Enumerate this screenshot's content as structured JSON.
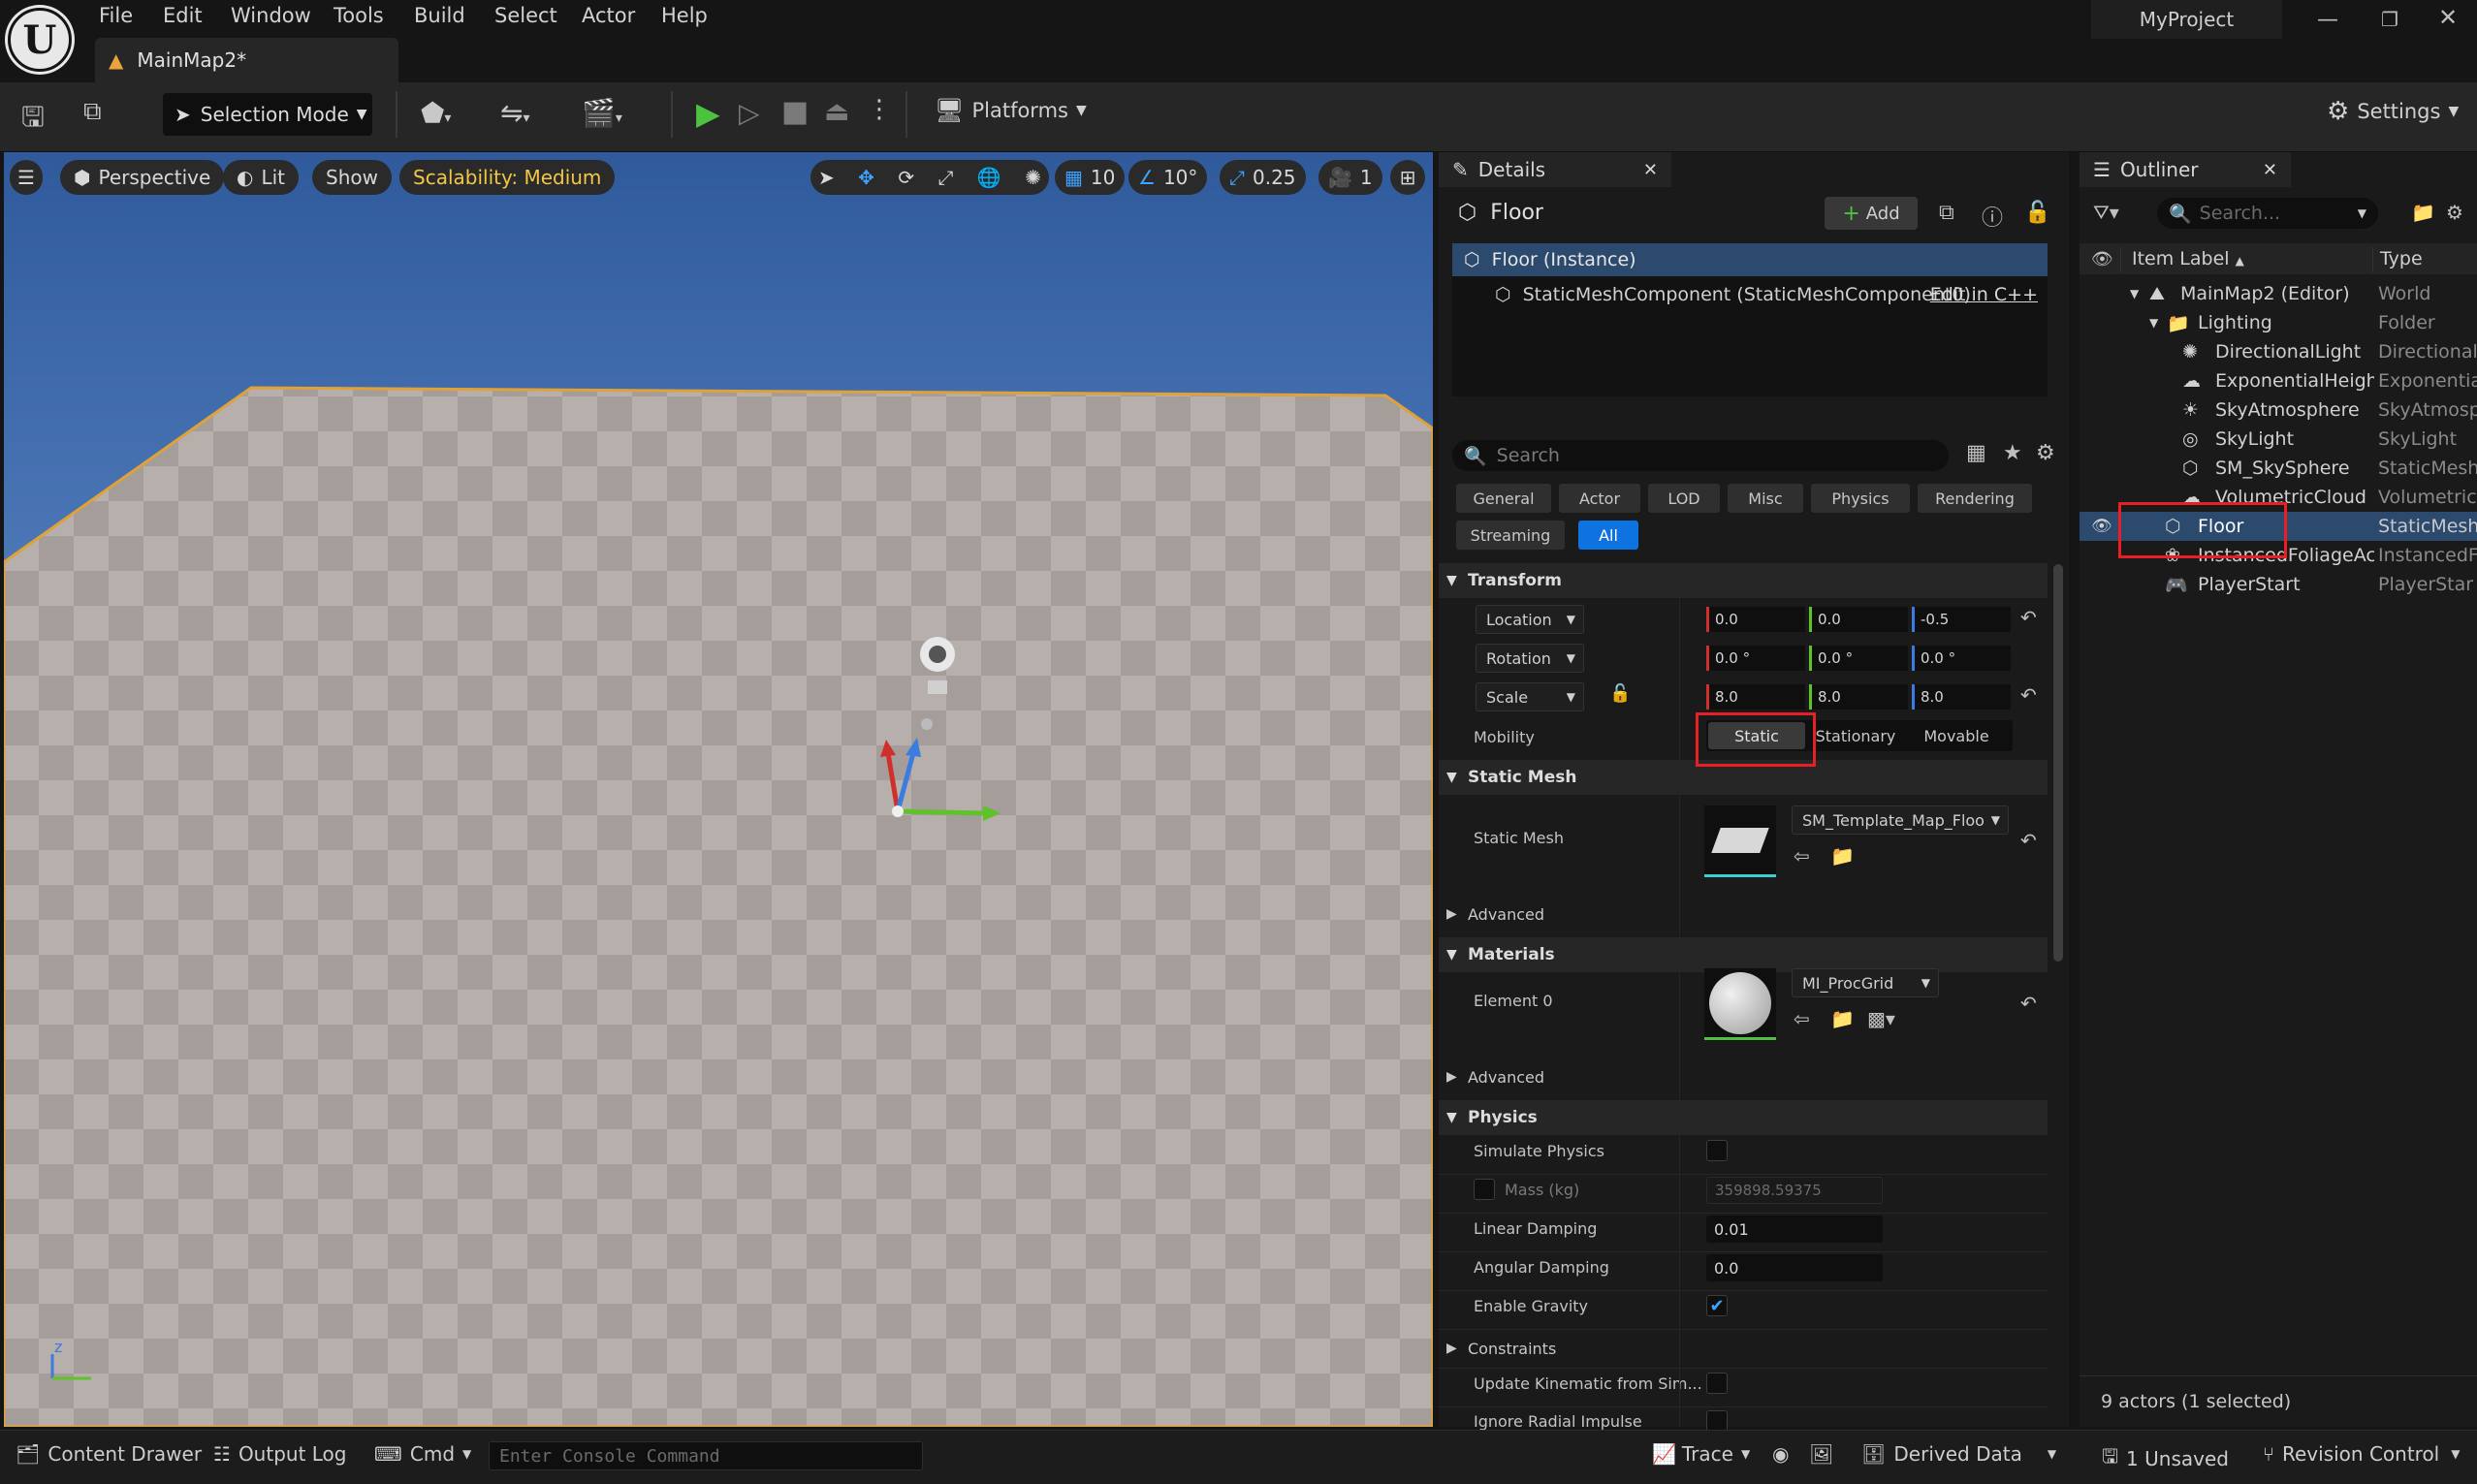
{
  "menu": [
    "File",
    "Edit",
    "Window",
    "Tools",
    "Build",
    "Select",
    "Actor",
    "Help"
  ],
  "map_tab": "MainMap2*",
  "project_name": "MyProject",
  "toolbar": {
    "selection_mode": "Selection Mode",
    "platforms": "Platforms",
    "settings": "Settings"
  },
  "viewport": {
    "perspective": "Perspective",
    "lit": "Lit",
    "show": "Show",
    "scalability": "Scalability: Medium",
    "grid_snap": "10",
    "rotation_snap": "10°",
    "scale_snap": "0.25",
    "camera_speed": "1"
  },
  "details": {
    "tab": "Details",
    "actor_name": "Floor",
    "add_label": "Add",
    "tree_instance": "Floor (Instance)",
    "tree_component": "StaticMeshComponent (StaticMeshComponent0)",
    "edit_cpp": "Edit in C++",
    "search_placeholder": "Search",
    "filters": [
      "General",
      "Actor",
      "LOD",
      "Misc",
      "Physics",
      "Rendering",
      "Streaming",
      "All"
    ],
    "transform": {
      "header": "Transform",
      "location_label": "Location",
      "rotation_label": "Rotation",
      "scale_label": "Scale",
      "location": [
        "0.0",
        "0.0",
        "-0.5"
      ],
      "rotation": [
        "0.0 °",
        "0.0 °",
        "0.0 °"
      ],
      "scale": [
        "8.0",
        "8.0",
        "8.0"
      ],
      "mobility_label": "Mobility",
      "mobility": [
        "Static",
        "Stationary",
        "Movable"
      ]
    },
    "static_mesh": {
      "header": "Static Mesh",
      "label": "Static Mesh",
      "value": "SM_Template_Map_Floo",
      "advanced": "Advanced"
    },
    "materials": {
      "header": "Materials",
      "label": "Element 0",
      "value": "MI_ProcGrid",
      "advanced": "Advanced"
    },
    "physics": {
      "header": "Physics",
      "simulate": "Simulate Physics",
      "mass_label": "Mass (kg)",
      "mass_value": "359898.59375",
      "linear_label": "Linear Damping",
      "linear_value": "0.01",
      "angular_label": "Angular Damping",
      "angular_value": "0.0",
      "gravity_label": "Enable Gravity",
      "constraints": "Constraints",
      "update_kinematic": "Update Kinematic from Sim...",
      "ignore_radial": "Ignore Radial Impulse"
    }
  },
  "outliner": {
    "tab": "Outliner",
    "search_placeholder": "Search...",
    "col_label": "Item Label",
    "col_type": "Type",
    "items": [
      {
        "label": "MainMap2 (Editor)",
        "type": "World"
      },
      {
        "label": "Lighting",
        "type": "Folder"
      },
      {
        "label": "DirectionalLight",
        "type": "Directional"
      },
      {
        "label": "ExponentialHeight",
        "type": "Exponentia"
      },
      {
        "label": "SkyAtmosphere",
        "type": "SkyAtmosp"
      },
      {
        "label": "SkyLight",
        "type": "SkyLight"
      },
      {
        "label": "SM_SkySphere",
        "type": "StaticMesh"
      },
      {
        "label": "VolumetricCloud",
        "type": "Volumetric"
      },
      {
        "label": "Floor",
        "type": "StaticMesh"
      },
      {
        "label": "InstancedFoliageAct",
        "type": "InstancedF"
      },
      {
        "label": "PlayerStart",
        "type": "PlayerStar"
      }
    ],
    "footer": "9 actors (1 selected)"
  },
  "statusbar": {
    "content_drawer": "Content Drawer",
    "output_log": "Output Log",
    "cmd": "Cmd",
    "console_placeholder": "Enter Console Command",
    "trace": "Trace",
    "derived_data": "Derived Data",
    "unsaved": "1 Unsaved",
    "revision_control": "Revision Control"
  },
  "colors": {
    "accent": "#0e73e0",
    "selection": "#1a4a7a",
    "highlight_box": "#e81f24",
    "scalability": "#f2c744"
  }
}
